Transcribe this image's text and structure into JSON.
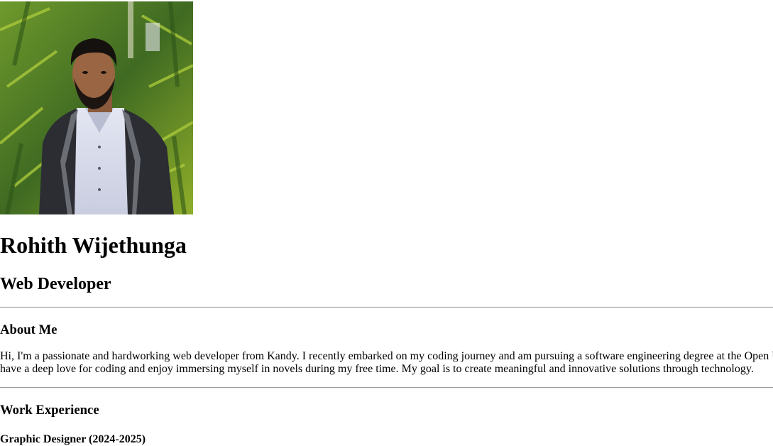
{
  "profile": {
    "photo_alt": "profile-photo",
    "name": "Rohith Wijethunga",
    "title": "Web Developer"
  },
  "about": {
    "heading": "About Me",
    "text": "Hi, I'm a passionate and hardworking web developer from Kandy. I recently embarked on my coding journey and am pursuing a software engineering degree at the Open University. I have a deep love for coding and enjoy immersing myself in novels during my free time. My goal is to create meaningful and innovative solutions through technology."
  },
  "work": {
    "heading": "Work Experience",
    "jobs": [
      {
        "title": "Graphic Designer (2024-2025)"
      }
    ]
  },
  "colors": {
    "background": "#ffffff",
    "text": "#000000",
    "rule": "#9a9a9a"
  }
}
